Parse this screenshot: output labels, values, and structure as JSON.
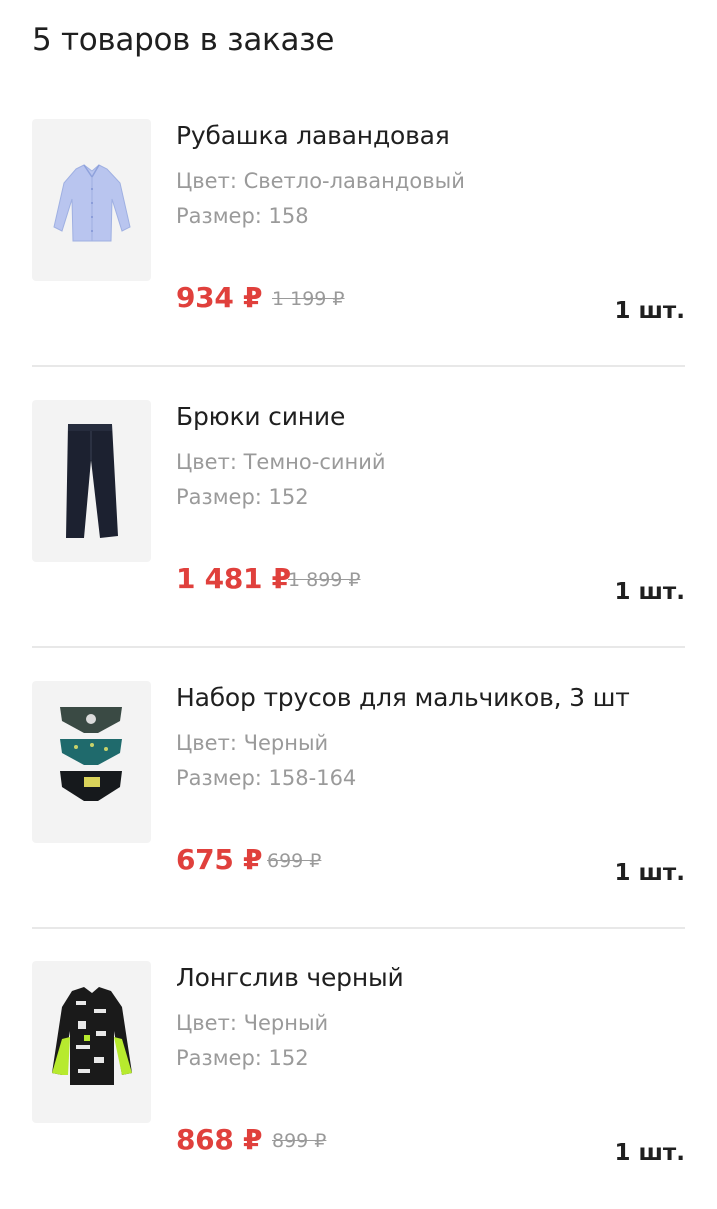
{
  "order": {
    "title": "5 товаров в заказе"
  },
  "items": [
    {
      "name": "Рубашка лавандовая",
      "color": "Цвет: Светло-лавандовый",
      "size": "Размер: 158",
      "price": "934 ₽",
      "old_price": "1 199 ₽",
      "qty": "1 шт.",
      "image_icon": "lavender-shirt-image"
    },
    {
      "name": "Брюки синие",
      "color": "Цвет: Темно-синий",
      "size": "Размер: 152",
      "price": "1 481 ₽",
      "old_price": "1 899 ₽",
      "qty": "1 шт.",
      "image_icon": "navy-trousers-image"
    },
    {
      "name": "Набор трусов для мальчиков, 3 шт",
      "color": "Цвет: Черный",
      "size": "Размер: 158-164",
      "price": "675 ₽",
      "old_price": "699 ₽",
      "qty": "1 шт.",
      "image_icon": "briefs-set-image"
    },
    {
      "name": "Лонгслив черный",
      "color": "Цвет: Черный",
      "size": "Размер: 152",
      "price": "868 ₽",
      "old_price": "899 ₽",
      "qty": "1 шт.",
      "image_icon": "black-longsleeve-image"
    }
  ],
  "colors": {
    "price_accent": "#e0403c",
    "text_primary": "#1f1f1f",
    "text_secondary": "#9a9a9a",
    "divider": "#e8e8e8",
    "thumb_bg": "#f3f3f3"
  }
}
